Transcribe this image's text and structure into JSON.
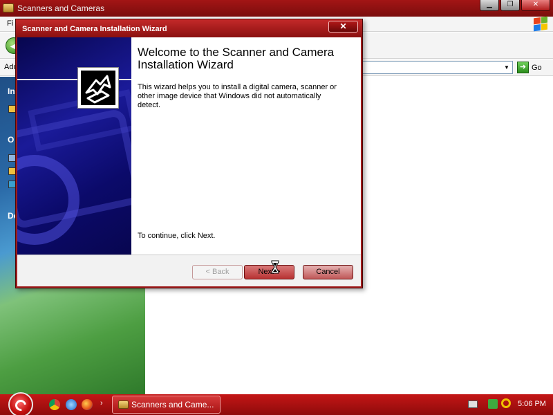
{
  "explorer": {
    "title": "Scanners and Cameras",
    "menu_file": "Fi",
    "address_label": "Add",
    "go_label": "Go",
    "taskpane": {
      "letters": [
        "In",
        "O",
        "De"
      ]
    }
  },
  "wizard": {
    "title": "Scanner and Camera Installation Wizard",
    "close_label": "✕",
    "heading": "Welcome to the Scanner and Camera Installation Wizard",
    "description": "This wizard helps you to install a digital camera, scanner or other image device that Windows did not automatically detect.",
    "continue_text": "To continue, click Next.",
    "buttons": {
      "back": "< Back",
      "next": "Next >",
      "cancel": "Cancel"
    }
  },
  "taskbar": {
    "task_label": "Scanners and Came...",
    "clock": "5:06 PM",
    "more": "›"
  },
  "colors": {
    "theme_red": "#9e1b1b",
    "wizard_side": "#0b0a6a"
  }
}
